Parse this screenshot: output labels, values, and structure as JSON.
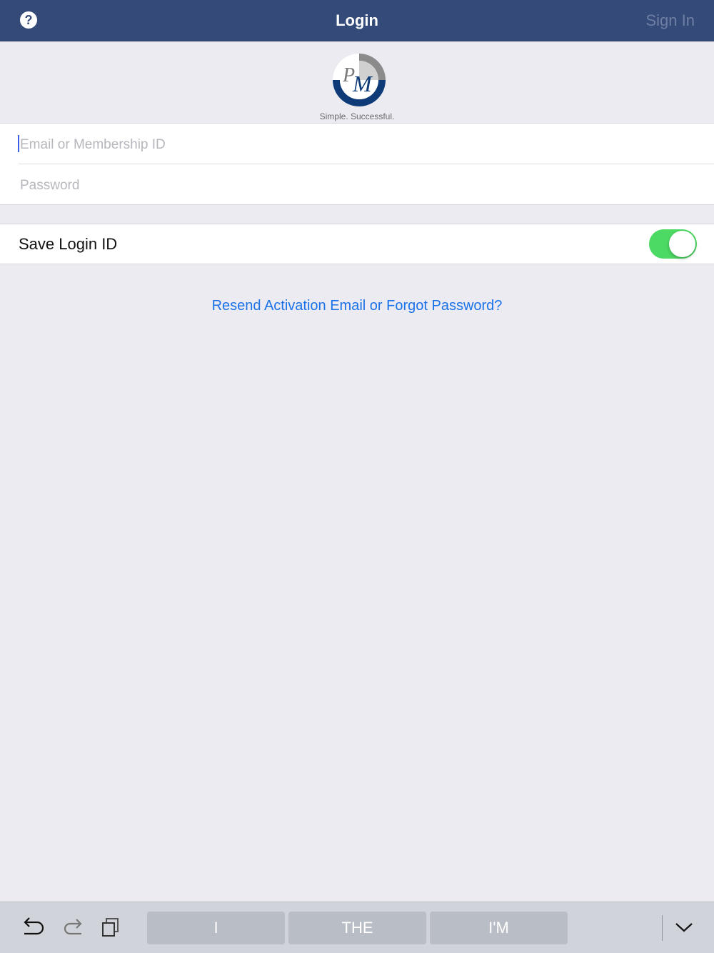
{
  "navbar": {
    "help_icon": "question-mark-icon",
    "help_glyph": "?",
    "title": "Login",
    "signin_label": "Sign In",
    "bg_color": "#344a78"
  },
  "logo": {
    "initials": "PM",
    "letter_p": "P",
    "letter_m": "M",
    "tagline": "Simple. Successful."
  },
  "form": {
    "email_value": "",
    "email_placeholder": "Email or Membership ID",
    "password_value": "",
    "password_placeholder": "Password"
  },
  "save_login": {
    "label": "Save Login ID",
    "enabled": true,
    "on_color": "#4cd964"
  },
  "links": {
    "forgot": "Resend Activation Email or Forgot Password?",
    "link_color": "#1a73e8"
  },
  "keyboard": {
    "undo_icon": "undo-icon",
    "redo_icon": "redo-icon",
    "paste_icon": "paste-icon",
    "suggestions": [
      "I",
      "THE",
      "I'M"
    ],
    "dismiss_icon": "chevron-down-icon"
  }
}
